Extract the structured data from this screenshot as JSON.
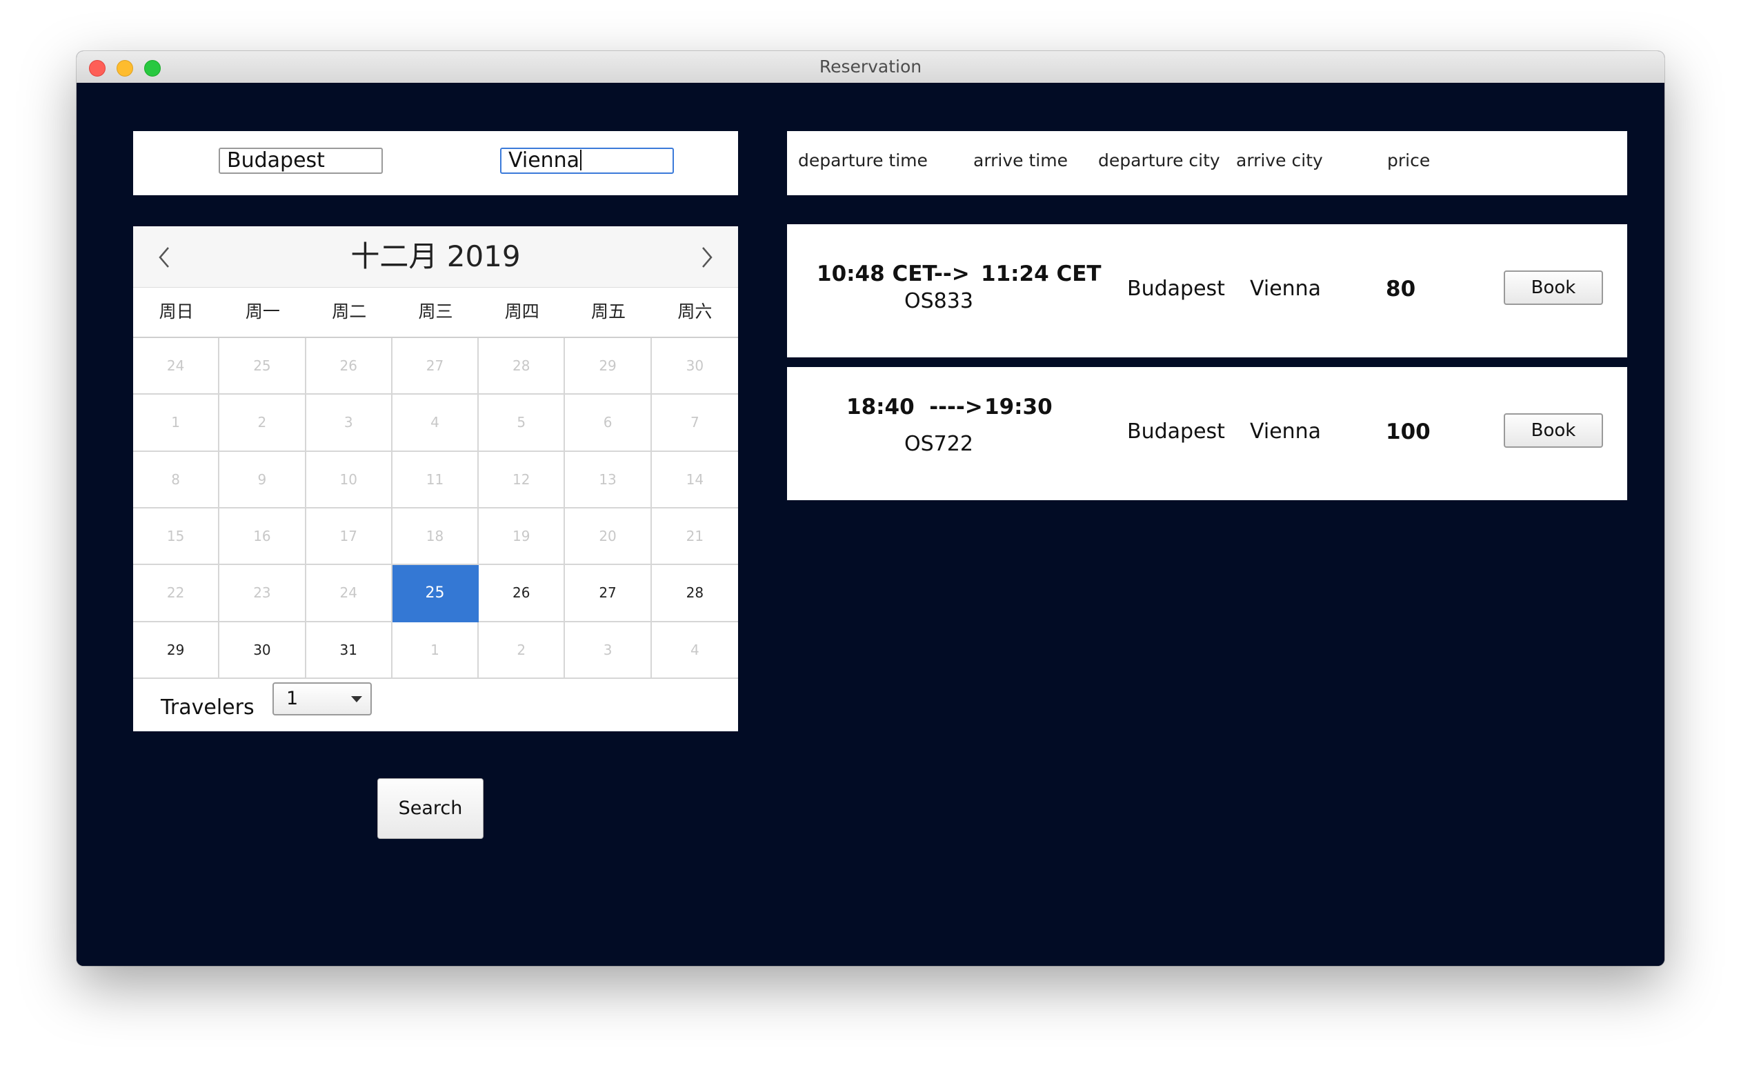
{
  "window": {
    "title": "Reservation"
  },
  "route": {
    "from": "Budapest",
    "to": "Vienna"
  },
  "calendar": {
    "title": "十二月 2019",
    "weekdays": [
      "周日",
      "周一",
      "周二",
      "周三",
      "周四",
      "周五",
      "周六"
    ],
    "weeks": [
      [
        "24",
        "25",
        "26",
        "27",
        "28",
        "29",
        "30"
      ],
      [
        "1",
        "2",
        "3",
        "4",
        "5",
        "6",
        "7"
      ],
      [
        "8",
        "9",
        "10",
        "11",
        "12",
        "13",
        "14"
      ],
      [
        "15",
        "16",
        "17",
        "18",
        "19",
        "20",
        "21"
      ],
      [
        "22",
        "23",
        "24",
        "25",
        "26",
        "27",
        "28"
      ],
      [
        "29",
        "30",
        "31",
        "1",
        "2",
        "3",
        "4"
      ]
    ],
    "selected_day": "25"
  },
  "travelers": {
    "label": "Travelers",
    "value": "1"
  },
  "search": {
    "label": "Search"
  },
  "results_header": {
    "departure_time": "departure time",
    "arrive_time": "arrive time",
    "departure_city": "departure city",
    "arrive_city": "arrive city",
    "price": "price"
  },
  "results": [
    {
      "departure": "10:48 CET-->",
      "arrival": "11:24 CET",
      "flight": "OS833",
      "departure_city": "Budapest",
      "arrive_city": "Vienna",
      "price": "80",
      "book_label": "Book"
    },
    {
      "departure": "18:40  ---->",
      "arrival": "19:30",
      "flight": "OS722",
      "departure_city": "Budapest",
      "arrive_city": "Vienna",
      "price": "100",
      "book_label": "Book"
    }
  ]
}
